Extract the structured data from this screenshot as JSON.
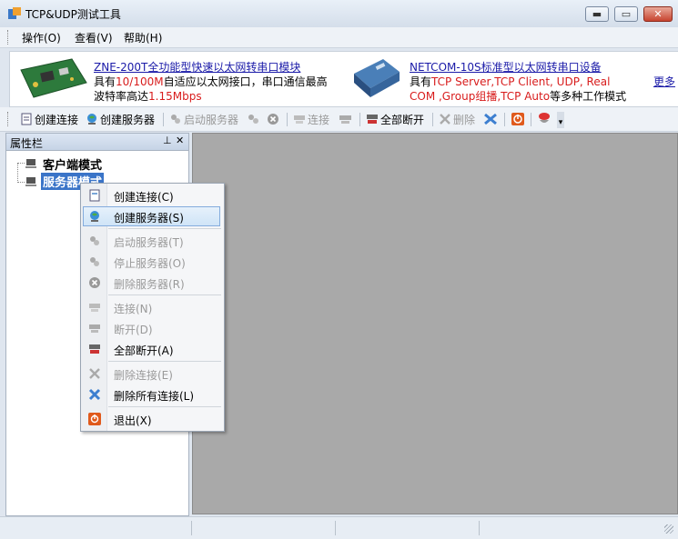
{
  "window": {
    "title": "TCP&UDP测试工具",
    "min_glyph": "▬",
    "max_glyph": "▭",
    "close_glyph": "✕"
  },
  "menubar": {
    "items": [
      "操作(O)",
      "查看(V)",
      "帮助(H)"
    ]
  },
  "banner": {
    "ad1": {
      "title": "ZNE-200T全功能型快速以太网转串口模块",
      "line2_a": "具有",
      "line2_red": "10/100M",
      "line2_b": "自适应以太网接口，串口通信最高",
      "line3_a": "波特率高达",
      "line3_red": "1.15Mbps"
    },
    "ad2": {
      "title": "NETCOM-10S标准型以太网转串口设备",
      "line2_a": "具有",
      "line2_red": "TCP Server,TCP Client, UDP, Real",
      "line3_red1": "COM ,Group组播,TCP Auto",
      "line3_b": "等多种工作模式"
    },
    "more": "更多"
  },
  "toolbar": {
    "create_conn": "创建连接",
    "create_server": "创建服务器",
    "start_server": "启动服务器",
    "connect": "连接",
    "disconnect_all": "全部断开",
    "delete": "删除"
  },
  "panel": {
    "title": "属性栏",
    "pin": "ᵩ",
    "close": "✕",
    "tree": [
      "客户端模式",
      "服务器模式"
    ]
  },
  "context_menu": {
    "items": [
      {
        "label": "创建连接(C)",
        "icon": "new-connection-icon",
        "enabled": true
      },
      {
        "label": "创建服务器(S)",
        "icon": "globe-server-icon",
        "enabled": true,
        "highlighted": true
      },
      {
        "label": "启动服务器(T)",
        "icon": "start-server-icon",
        "enabled": false
      },
      {
        "label": "停止服务器(O)",
        "icon": "stop-server-icon",
        "enabled": false
      },
      {
        "label": "删除服务器(R)",
        "icon": "delete-server-icon",
        "enabled": false
      },
      {
        "label": "连接(N)",
        "icon": "connect-icon",
        "enabled": false
      },
      {
        "label": "断开(D)",
        "icon": "disconnect-icon",
        "enabled": false
      },
      {
        "label": "全部断开(A)",
        "icon": "disconnect-all-icon",
        "enabled": true
      },
      {
        "label": "删除连接(E)",
        "icon": "delete-connection-icon",
        "enabled": false
      },
      {
        "label": "删除所有连接(L)",
        "icon": "delete-all-icon",
        "enabled": true
      },
      {
        "label": "退出(X)",
        "icon": "exit-icon",
        "enabled": true
      }
    ]
  },
  "colors": {
    "accent_red": "#d81c1c",
    "link_blue": "#1a1aa8",
    "workspace": "#a9a9a9"
  }
}
